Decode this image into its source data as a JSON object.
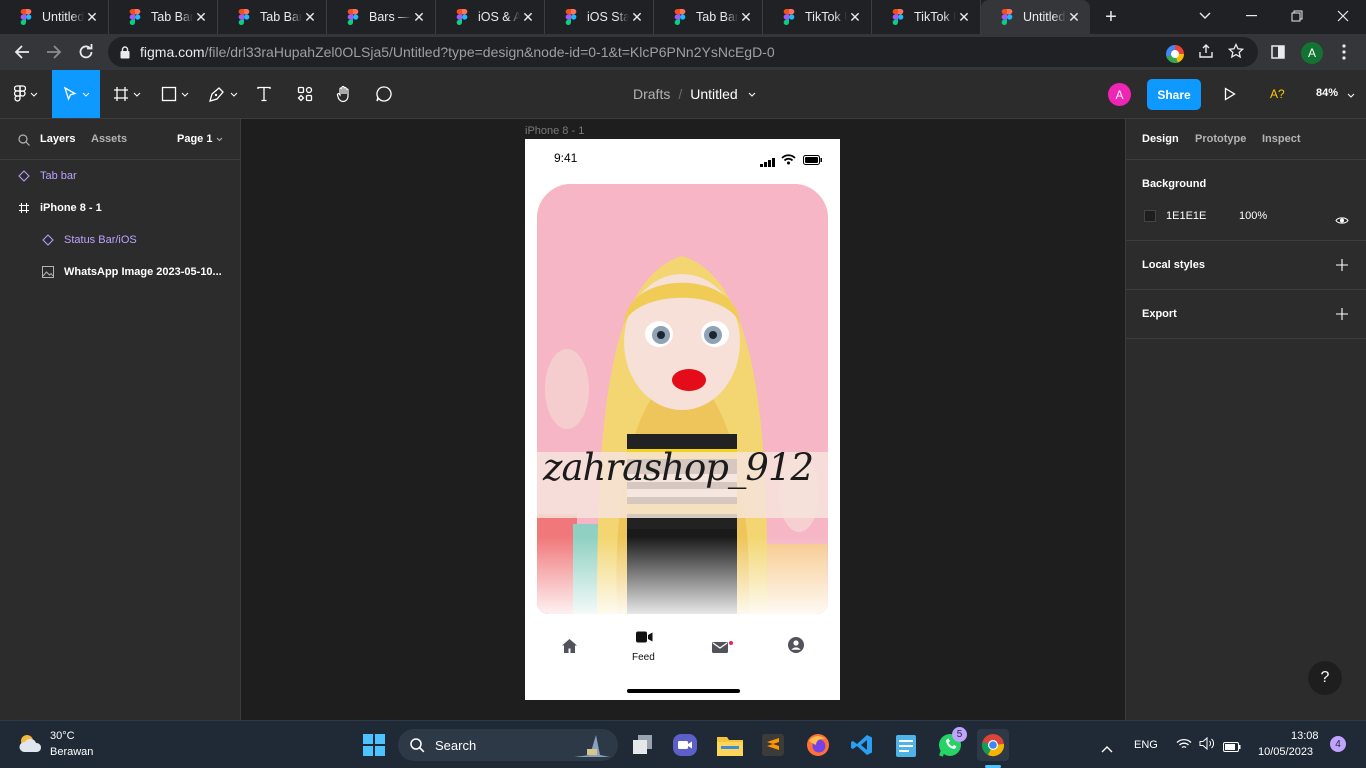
{
  "browser": {
    "tabs": [
      {
        "label": "Untitled"
      },
      {
        "label": "Tab Bar"
      },
      {
        "label": "Tab Bar"
      },
      {
        "label": "Bars — F"
      },
      {
        "label": "iOS & An"
      },
      {
        "label": "iOS Statu"
      },
      {
        "label": "Tab Bar"
      },
      {
        "label": "TikTok U"
      },
      {
        "label": "TikTok U"
      },
      {
        "label": "Untitled"
      }
    ],
    "url_host": "figma.com",
    "url_path": "/file/drl33raHupahZel0OLSja5/Untitled?type=design&node-id=0-1&t=KlcP6PNn2YsNcEgD-0",
    "profile_initial": "A"
  },
  "figma": {
    "breadcrumb_parent": "Drafts",
    "breadcrumb_separator": "/",
    "file_name": "Untitled",
    "avatar_initial": "A",
    "share_label": "Share",
    "font_warning": "A?",
    "zoom": "84%",
    "left_tabs": {
      "layers": "Layers",
      "assets": "Assets",
      "page": "Page 1"
    },
    "layers": [
      {
        "name": "Tab bar"
      },
      {
        "name": "iPhone 8 - 1"
      },
      {
        "name": "Status Bar/iOS"
      },
      {
        "name": "WhatsApp Image 2023-05-10..."
      }
    ],
    "frame_label": "iPhone 8 - 1",
    "right_tabs": {
      "design": "Design",
      "prototype": "Prototype",
      "inspect": "Inspect"
    },
    "background_title": "Background",
    "background_hex": "1E1E1E",
    "background_opacity": "100%",
    "local_styles": "Local styles",
    "export": "Export",
    "help": "?"
  },
  "phone": {
    "time": "9:41",
    "watermark": "zahrashop_912",
    "tab_active_label": "Feed",
    "colors": {
      "pink": "#f7b5c6",
      "hair": "#f3d671"
    }
  },
  "taskbar": {
    "weather_temp": "30°C",
    "weather_desc": "Berawan",
    "search_label": "Search",
    "language": "ENG",
    "time": "13:08",
    "date": "10/05/2023",
    "whatsapp_badge": "5",
    "notification_count": "4"
  }
}
